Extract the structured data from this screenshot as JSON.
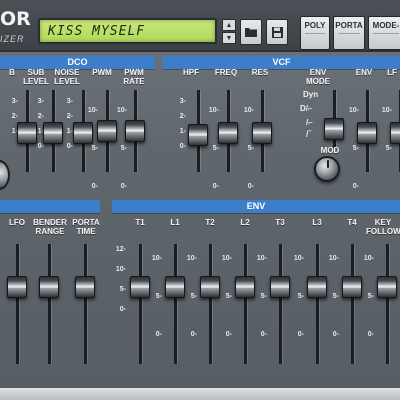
{
  "header": {
    "logo_text": "OR",
    "logo_subtext": "IZER",
    "lcd_text": "KISS MYSELF",
    "scroll_up": "▲",
    "scroll_down": "▼",
    "buttons": [
      {
        "key": "poly",
        "label": "POLY"
      },
      {
        "key": "porta",
        "label": "PORTA"
      },
      {
        "key": "mode",
        "label": "MODE-"
      }
    ],
    "folder_icon": "folder-icon",
    "save_icon": "save-icon"
  },
  "sections": {
    "dco": "DCO",
    "vcf": "VCF",
    "env": "ENV"
  },
  "top_sliders": [
    {
      "key": "b",
      "label": "B",
      "scale": [
        "3",
        "2",
        "1"
      ],
      "level": 0.45
    },
    {
      "key": "sub-level",
      "label": "SUB\nLEVEL",
      "scale": [
        "3",
        "2",
        "1",
        "0"
      ],
      "level": 0.45
    },
    {
      "key": "noise-level",
      "label": "NOISE\nLEVEL",
      "scale": [
        "3",
        "2",
        "1",
        "0"
      ],
      "level": 0.45
    },
    {
      "key": "pwm",
      "label": "PWM",
      "scale": [
        "10",
        "5",
        "0"
      ],
      "level": 0.55
    },
    {
      "key": "pwm-rate",
      "label": "PWM\nRATE",
      "scale": [
        "10",
        "5",
        "0"
      ],
      "level": 0.55
    },
    {
      "key": "hpf",
      "label": "HPF",
      "scale": [
        "3",
        "2",
        "1",
        "0"
      ],
      "level": 0.5
    },
    {
      "key": "freq",
      "label": "FREQ",
      "scale": [
        "10",
        "5",
        "0"
      ],
      "level": 0.45
    },
    {
      "key": "res",
      "label": "RES",
      "scale": [
        "10",
        "5",
        "0"
      ],
      "level": 0.45
    },
    {
      "key": "env",
      "label": "ENV",
      "scale": [
        "10",
        "5",
        "0"
      ],
      "level": 0.45
    },
    {
      "key": "lfo",
      "label": "LF",
      "scale": [
        "10",
        "5"
      ],
      "level": 0.45
    }
  ],
  "env_mode": {
    "label": "ENV\nMODE",
    "scale": [
      "Dyn",
      "D/\\",
      "/\\",
      "/\\"
    ],
    "knob_label": "MOD"
  },
  "bottom_sliders": [
    {
      "key": "lfo-bottom",
      "label": "LFO",
      "scale": [
        "10",
        "5",
        "0"
      ],
      "level": 0.5
    },
    {
      "key": "bender-range",
      "label": "BENDER\nRANGE",
      "scale": [],
      "level": 0.5
    },
    {
      "key": "porta-time",
      "label": "PORTA\nTIME",
      "scale": [],
      "level": 0.5
    },
    {
      "key": "t1",
      "label": "T1",
      "scale": [
        "12",
        "10",
        "5",
        "0"
      ],
      "level": 0.5
    },
    {
      "key": "l1",
      "label": "L1",
      "scale": [
        "10",
        "5",
        "0"
      ],
      "level": 0.5
    },
    {
      "key": "t2",
      "label": "T2",
      "scale": [
        "10",
        "5",
        "0"
      ],
      "level": 0.5
    },
    {
      "key": "l2",
      "label": "L2",
      "scale": [
        "10",
        "5",
        "0"
      ],
      "level": 0.5
    },
    {
      "key": "t3",
      "label": "T3",
      "scale": [
        "10",
        "5",
        "0"
      ],
      "level": 0.5
    },
    {
      "key": "l3",
      "label": "L3",
      "scale": [
        "10",
        "5",
        "0"
      ],
      "level": 0.5
    },
    {
      "key": "t4",
      "label": "T4",
      "scale": [
        "10",
        "5",
        "0"
      ],
      "level": 0.5
    },
    {
      "key": "key-follow",
      "label": "KEY\nFOLLOW",
      "scale": [
        "10",
        "5",
        "0"
      ],
      "level": 0.5
    }
  ],
  "colors": {
    "section_header": "#3d7ecb",
    "lcd_background": "#b2d85c",
    "panel": "#5f676d"
  }
}
